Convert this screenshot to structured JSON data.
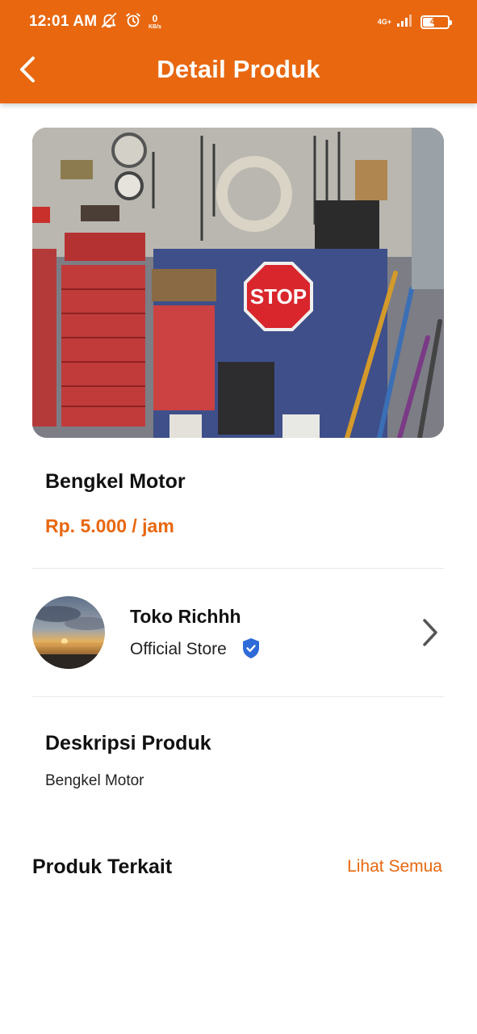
{
  "status_bar": {
    "time": "12:01 AM",
    "net_speed_value": "0",
    "net_speed_unit": "KB/s",
    "network_type": "4G+",
    "battery_level": "46",
    "battery_percent": 46
  },
  "app_bar": {
    "title": "Detail Produk"
  },
  "product": {
    "image_description_icon": "garage-workshop-photo",
    "name": "Bengkel Motor",
    "price": "Rp. 5.000 / jam"
  },
  "store": {
    "name": "Toko Richhh",
    "type": "Official Store",
    "verified": true
  },
  "description": {
    "title": "Deskripsi Produk",
    "text": "Bengkel Motor"
  },
  "related": {
    "title": "Produk Terkait",
    "see_all": "Lihat Semua"
  },
  "colors": {
    "accent": "#e8670f",
    "verified_badge": "#2f6bd8"
  }
}
